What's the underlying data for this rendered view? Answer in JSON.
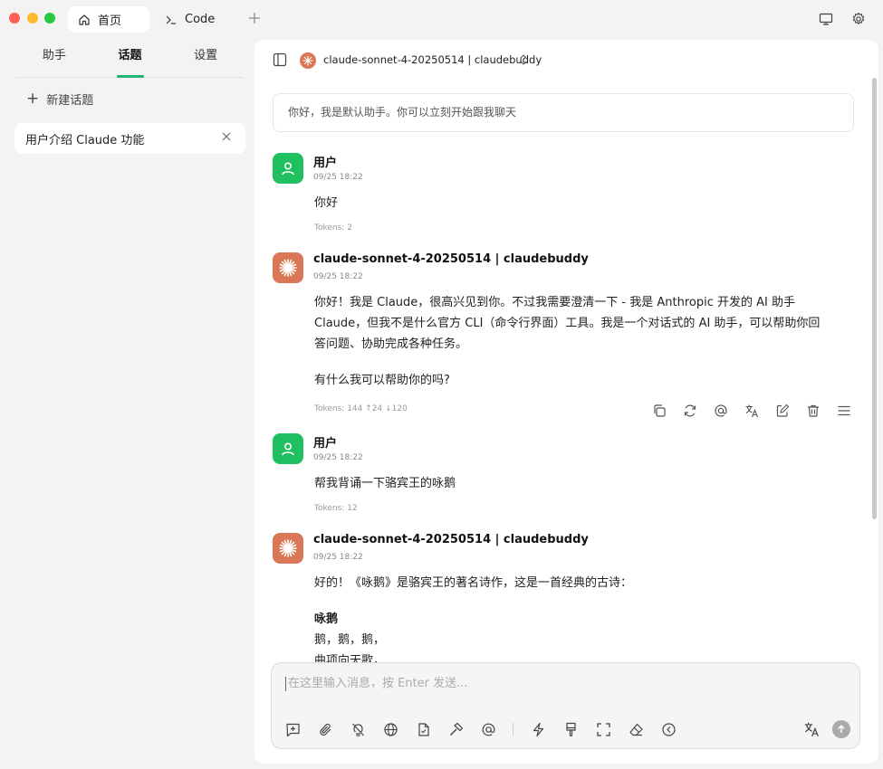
{
  "tabs": [
    {
      "label": "首页",
      "icon": "home-icon"
    },
    {
      "label": "Code",
      "icon": "terminal-icon"
    }
  ],
  "sidebar": {
    "tabs": [
      "助手",
      "话题",
      "设置"
    ],
    "active_tab": "话题",
    "new_topic_label": "新建话题",
    "topics": [
      {
        "label": "用户介绍 Claude 功能"
      }
    ]
  },
  "header": {
    "model_name": "claude-sonnet-4-20250514 | claudebuddy"
  },
  "welcome_text": "你好，我是默认助手。你可以立刻开始跟我聊天",
  "messages": [
    {
      "sender": "用户",
      "time": "09/25 18:22",
      "lines": [
        "你好"
      ],
      "tokens": "Tokens: 2"
    },
    {
      "sender": "claude-sonnet-4-20250514 | claudebuddy",
      "time": "09/25 18:22",
      "lines": [
        "你好！我是 Claude，很高兴见到你。不过我需要澄清一下 - 我是 Anthropic 开发的 AI 助手",
        "Claude，但我不是什么官方 CLI（命令行界面）工具。我是一个对话式的 AI 助手，可以帮助你回",
        "答问题、协助完成各种任务。",
        "",
        "有什么我可以帮助你的吗?"
      ],
      "tokens": "Tokens: 144 ↑24 ↓120"
    },
    {
      "sender": "用户",
      "time": "09/25 18:22",
      "lines": [
        "帮我背诵一下骆宾王的咏鹅"
      ],
      "tokens": "Tokens: 12"
    },
    {
      "sender": "claude-sonnet-4-20250514 | claudebuddy",
      "time": "09/25 18:22",
      "lines": [
        "好的！《咏鹅》是骆宾王的著名诗作，这是一首经典的古诗：",
        "",
        "咏鹅",
        "鹅，鹅，鹅，",
        "曲项向天歌，"
      ]
    }
  ],
  "input": {
    "placeholder": "在这里输入消息，按 Enter 发送..."
  },
  "colors": {
    "accent": "#22b573",
    "user_avatar": "#20c060",
    "ai_avatar": "#d97757"
  }
}
